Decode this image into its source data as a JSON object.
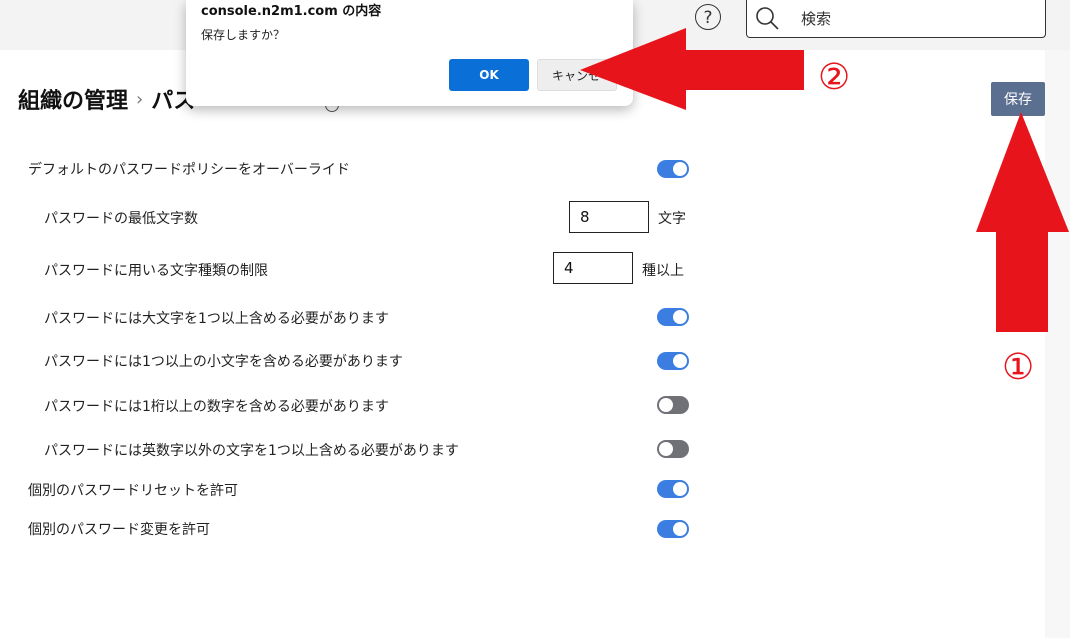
{
  "header": {
    "help_symbol": "?",
    "search_placeholder": "検索"
  },
  "page": {
    "title": "組織の管理",
    "breadcrumb_sep": "›",
    "title_sub": "パス",
    "save_label": "保存"
  },
  "settings": {
    "override": {
      "label": "デフォルトのパスワードポリシーをオーバーライド",
      "on": true
    },
    "min_length": {
      "label": "パスワードの最低文字数",
      "value": "8",
      "unit": "文字"
    },
    "char_types": {
      "label": "パスワードに用いる文字種類の制限",
      "value": "4",
      "unit": "種以上"
    },
    "uppercase": {
      "label": "パスワードには大文字を1つ以上含める必要があります",
      "on": true
    },
    "lowercase": {
      "label": "パスワードには1つ以上の小文字を含める必要があります",
      "on": true
    },
    "digit": {
      "label": "パスワードには1桁以上の数字を含める必要があります",
      "on": false
    },
    "symbol": {
      "label": "パスワードには英数字以外の文字を1つ以上含める必要があります",
      "on": false
    },
    "reset": {
      "label": "個別のパスワードリセットを許可",
      "on": true
    },
    "change": {
      "label": "個別のパスワード変更を許可",
      "on": true
    }
  },
  "dialog": {
    "title": "console.n2m1.com の内容",
    "message": "保存しますか？",
    "ok_label": "OK",
    "cancel_label": "キャンセ"
  },
  "annotations": {
    "step1": "①",
    "step2": "②",
    "arrow_color": "#e8141b"
  },
  "colors": {
    "toggle_on": "#3b7de0",
    "toggle_off": "#6f7177",
    "save_button": "#5b6f91",
    "ok_button": "#0a6fd6"
  }
}
